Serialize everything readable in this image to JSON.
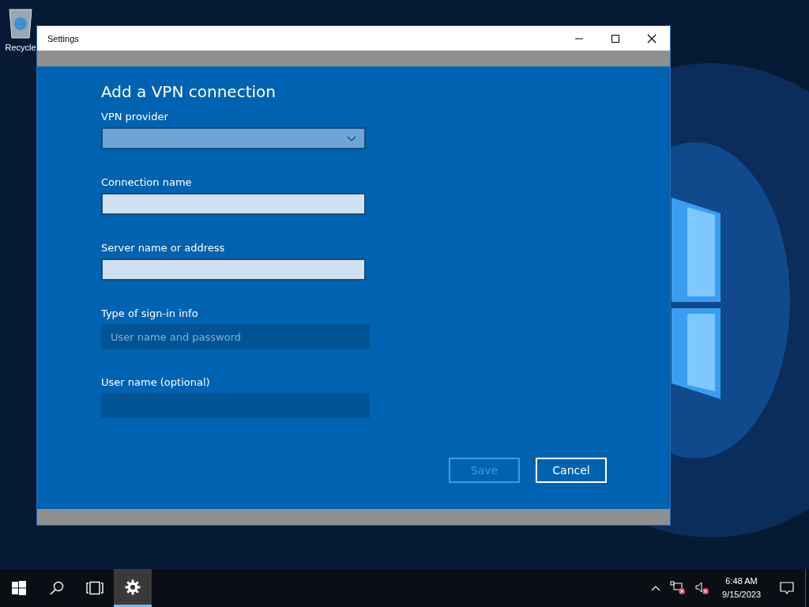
{
  "desktop": {
    "icons": [
      {
        "label": "Recycle"
      }
    ]
  },
  "window": {
    "title": "Settings",
    "heading": "Add a VPN connection",
    "fields": [
      {
        "label": "VPN provider",
        "kind": "dropdown",
        "disabled": false
      },
      {
        "label": "Connection name",
        "kind": "text",
        "disabled": false
      },
      {
        "label": "Server name or address",
        "kind": "text",
        "disabled": false
      },
      {
        "label": "Type of sign-in info",
        "kind": "dropdown",
        "value": "User name and password",
        "disabled": true
      },
      {
        "label": "User name (optional)",
        "kind": "text",
        "disabled": true
      }
    ],
    "buttons": [
      {
        "label": "Save",
        "disabled": true
      },
      {
        "label": "Cancel",
        "disabled": false
      }
    ]
  },
  "taskbar": {
    "buttons": [
      {
        "kind": "start",
        "selected": false
      },
      {
        "kind": "search",
        "selected": false
      },
      {
        "kind": "taskview",
        "selected": false
      },
      {
        "kind": "settings",
        "selected": true
      }
    ],
    "tray": [
      {
        "kind": "chevron"
      },
      {
        "kind": "network"
      },
      {
        "kind": "volume"
      }
    ],
    "clock": {
      "time": "6:48 AM",
      "date": "9/15/2023"
    }
  }
}
